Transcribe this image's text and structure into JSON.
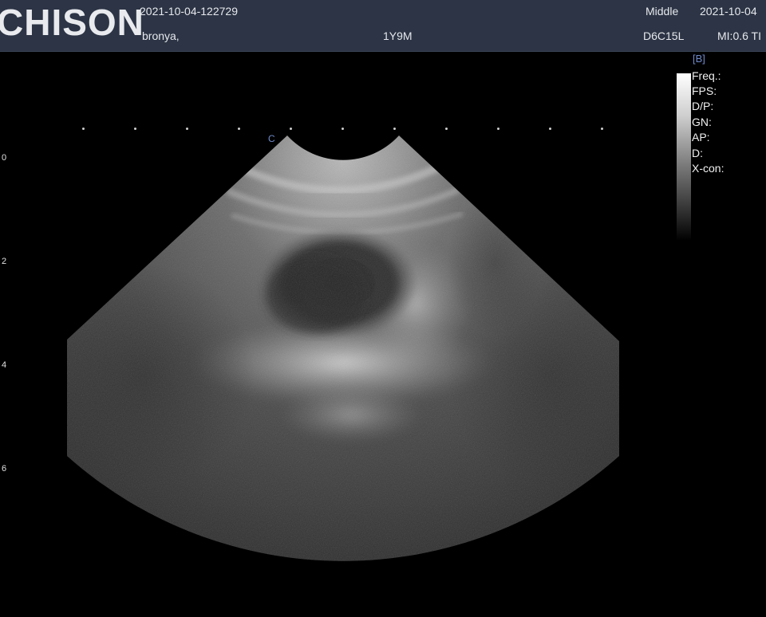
{
  "header": {
    "brand": "CHISON",
    "exam_id": "2021-10-04-122729",
    "patient_name": "bronya,",
    "patient_age": "1Y9M",
    "preset": "Middle",
    "date": "2021-10-04",
    "probe": "D6C15L",
    "mi_ti": "MI:0.6 TI"
  },
  "side_panel": {
    "mode": "[B]",
    "params": [
      "Freq.:",
      "FPS:",
      "D/P:",
      "GN:",
      "AP:",
      "D:",
      "X-con:"
    ]
  },
  "depth_scale": [
    "0",
    "2",
    "4",
    "6"
  ],
  "focus_marker": "C",
  "image": {
    "type": "ultrasound convex B-mode image",
    "background": "#000000"
  }
}
